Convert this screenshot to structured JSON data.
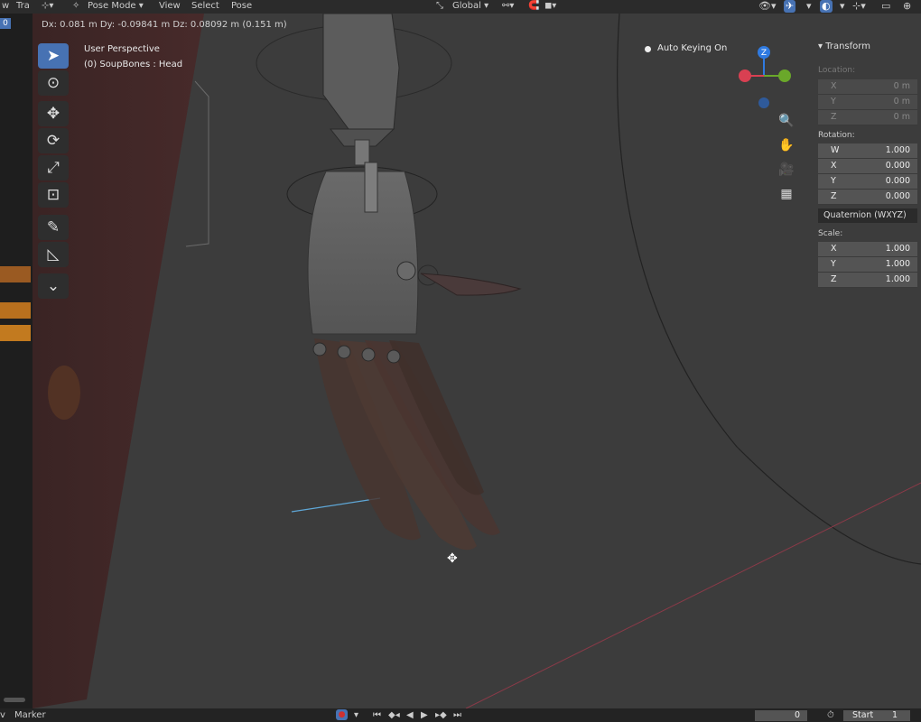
{
  "header": {
    "partial_left_1": "w",
    "partial_left_2": "Tra",
    "mode": "Pose Mode",
    "menus": [
      "View",
      "Select",
      "Pose"
    ],
    "orientation": "Global"
  },
  "status_line": "Dx: 0.081 m  Dy: -0.09841 m  Dz: 0.08092 m (0.151 m)",
  "left_strip": {
    "frame_number": "0"
  },
  "viewport": {
    "perspective_label": "User Perspective",
    "object_label": "(0) SoupBones : Head",
    "auto_keying": "Auto Keying On"
  },
  "tools": [
    "select-box",
    "cursor",
    "move",
    "rotate",
    "scale",
    "transform",
    "annotate",
    "measure",
    "pose-tool"
  ],
  "gizmo": {
    "z_label": "Z"
  },
  "transform_panel": {
    "title": "Transform",
    "location_label": "Location:",
    "location": [
      {
        "axis": "X",
        "value": "0 m"
      },
      {
        "axis": "Y",
        "value": "0 m"
      },
      {
        "axis": "Z",
        "value": "0 m"
      }
    ],
    "rotation_label": "Rotation:",
    "rotation": [
      {
        "axis": "W",
        "value": "1.000"
      },
      {
        "axis": "X",
        "value": "0.000"
      },
      {
        "axis": "Y",
        "value": "0.000"
      },
      {
        "axis": "Z",
        "value": "0.000"
      }
    ],
    "rotation_mode": "Quaternion (WXYZ)",
    "scale_label": "Scale:",
    "scale": [
      {
        "axis": "X",
        "value": "1.000"
      },
      {
        "axis": "Y",
        "value": "1.000"
      },
      {
        "axis": "Z",
        "value": "1.000"
      }
    ]
  },
  "bottom_bar": {
    "partial_left": "v",
    "marker": "Marker",
    "current_frame": "0",
    "start_label": "Start",
    "start_value": "1"
  },
  "colors": {
    "accent": "#4772b3",
    "gizmo_x": "#d94052",
    "gizmo_y": "#6aa82a",
    "gizmo_z": "#2f7ae0",
    "record": "#d03030"
  }
}
